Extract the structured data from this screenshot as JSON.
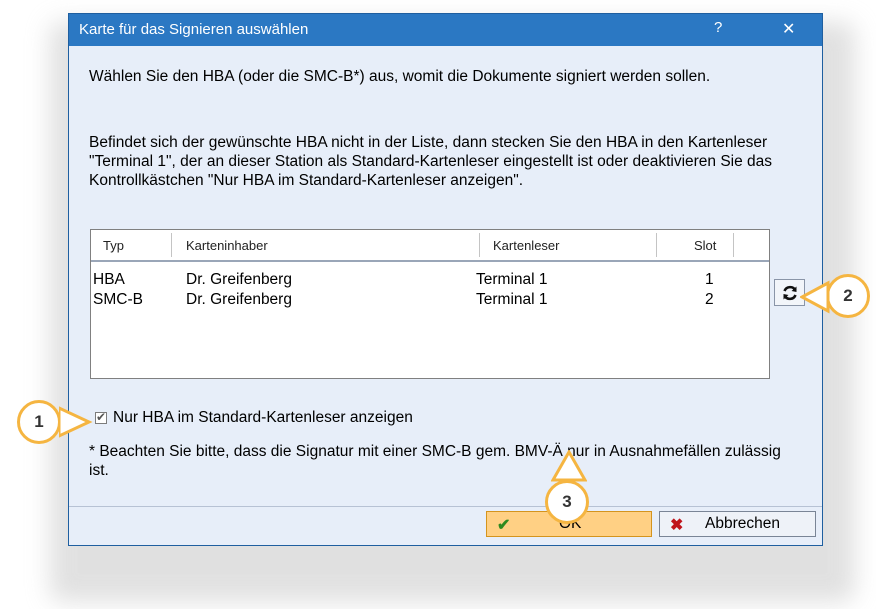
{
  "window": {
    "title": "Karte für das Signieren auswählen",
    "help_label": "?",
    "close_label": "✕"
  },
  "instructions": {
    "line1": "Wählen Sie den HBA (oder die SMC-B*) aus, womit die Dokumente signiert werden sollen.",
    "line2": "Befindet sich der gewünschte HBA nicht in der Liste, dann stecken Sie den HBA in den Kartenleser \"Terminal 1\", der an dieser Station als Standard-Kartenleser eingestellt ist oder deaktivieren Sie das Kontrollkästchen \"Nur HBA im Standard-Kartenleser anzeigen\"."
  },
  "table": {
    "columns": [
      "Typ",
      "Karteninhaber",
      "Kartenleser",
      "Slot"
    ],
    "rows": [
      {
        "typ": "HBA",
        "inhaber": "Dr. Greifenberg",
        "leser": "Terminal 1",
        "slot": "1"
      },
      {
        "typ": "SMC-B",
        "inhaber": "Dr. Greifenberg",
        "leser": "Terminal 1",
        "slot": "2"
      }
    ]
  },
  "refresh": {
    "icon": "refresh-icon"
  },
  "checkbox": {
    "label": "Nur HBA im Standard-Kartenleser anzeigen",
    "checked": true
  },
  "note": "* Beachten Sie bitte, dass die Signatur mit einer SMC-B gem. BMV-Ä nur in Ausnahmefällen zulässig ist.",
  "buttons": {
    "ok": "OK",
    "cancel": "Abbrechen"
  },
  "badges": [
    "1",
    "2",
    "3"
  ],
  "colors": {
    "titlebar": "#2b78c3",
    "badge_border": "#f5b541",
    "ok_bg": "#ffd084"
  }
}
